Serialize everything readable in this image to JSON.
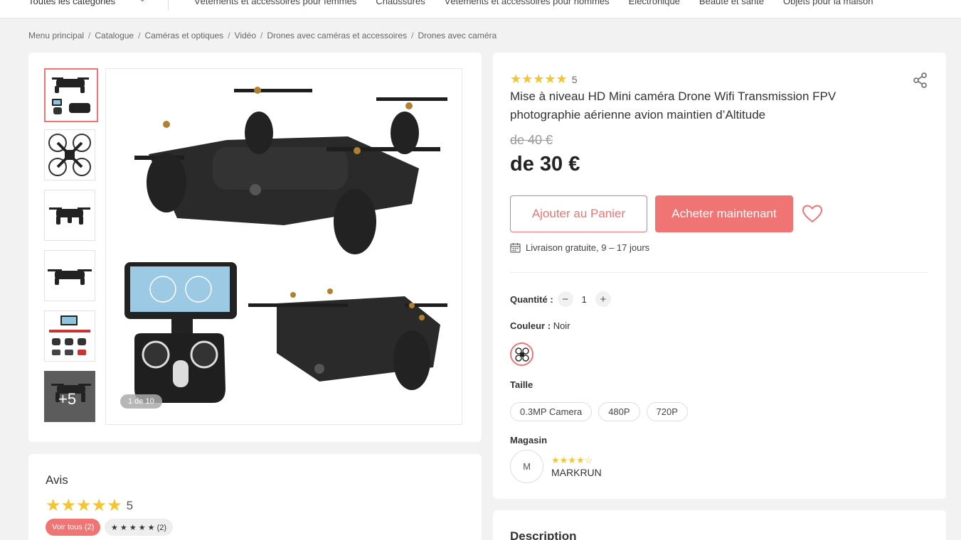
{
  "topnav": {
    "category_select": "Toutes les catégories",
    "links": [
      "Vêtements et accessoires pour femmes",
      "Chaussures",
      "Vêtements et accessoires pour hommes",
      "Électronique",
      "Beauté et santé",
      "Objets pour la maison"
    ]
  },
  "breadcrumb": [
    "Menu principal",
    "Catalogue",
    "Caméras et optiques",
    "Vidéo",
    "Drones avec caméras et accessoires",
    "Drones avec caméra"
  ],
  "gallery": {
    "counter": "1 de 10",
    "more_label": "+5"
  },
  "product": {
    "rating_stars": "★★★★★",
    "rating": "5",
    "title": "Mise à niveau HD Mini caméra Drone Wifi Transmission FPV photographie aérienne avion maintien d’Altitude",
    "old_price": "de 40 €",
    "price": "de 30 €",
    "add_to_cart": "Ajouter au Panier",
    "buy_now": "Acheter maintenant",
    "shipping": "Livraison gratuite, 9 – 17 jours",
    "quantity_label": "Quantité :",
    "quantity_minus": "−",
    "quantity_value": "1",
    "quantity_plus": "+",
    "color_label": "Couleur :",
    "color_value": "Noir",
    "size_label": "Taille",
    "sizes": [
      "0.3MP Camera",
      "480P",
      "720P"
    ],
    "store_label": "Magasin",
    "store_avatar": "M",
    "store_stars": "★★★★☆",
    "store_name": "MARKRUN"
  },
  "reviews": {
    "title": "Avis",
    "stars": "★★★★★",
    "rating": "5",
    "see_all": "Voir tous (2)",
    "five_star_filter": "★ ★ ★ ★ ★ (2)"
  },
  "description": {
    "title": "Description"
  },
  "colors": {
    "accent": "#f07473",
    "star": "#f5c430"
  }
}
